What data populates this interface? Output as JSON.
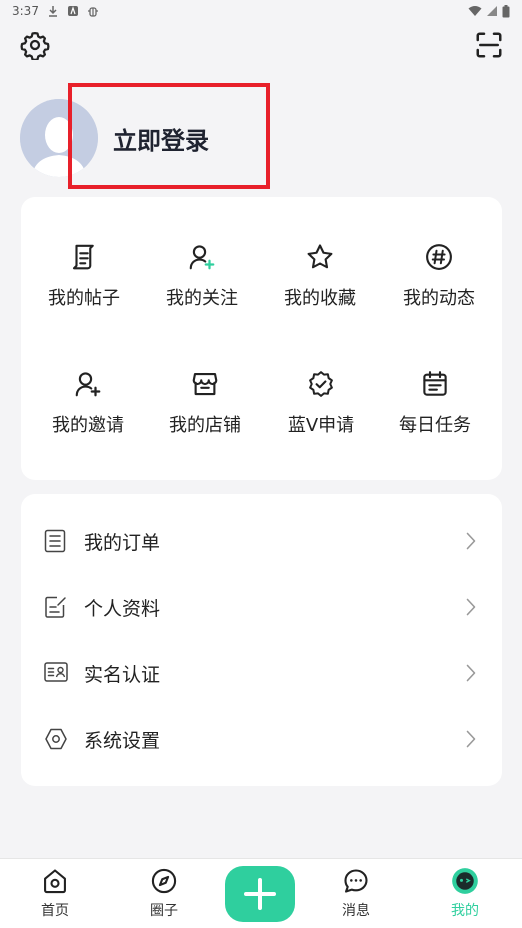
{
  "status_bar": {
    "time": "3:37"
  },
  "profile": {
    "login_label": "立即登录"
  },
  "grid": {
    "items": [
      {
        "label": "我的帖子",
        "icon": "post-icon"
      },
      {
        "label": "我的关注",
        "icon": "follow-user-icon"
      },
      {
        "label": "我的收藏",
        "icon": "star-icon"
      },
      {
        "label": "我的动态",
        "icon": "hashtag-icon"
      },
      {
        "label": "我的邀请",
        "icon": "invite-user-icon"
      },
      {
        "label": "我的店铺",
        "icon": "store-icon"
      },
      {
        "label": "蓝V申请",
        "icon": "verified-badge-icon"
      },
      {
        "label": "每日任务",
        "icon": "calendar-icon"
      }
    ]
  },
  "list": {
    "items": [
      {
        "label": "我的订单",
        "icon": "order-icon"
      },
      {
        "label": "个人资料",
        "icon": "edit-profile-icon"
      },
      {
        "label": "实名认证",
        "icon": "id-card-icon"
      },
      {
        "label": "系统设置",
        "icon": "hexagon-settings-icon"
      }
    ]
  },
  "tabs": [
    {
      "label": "首页",
      "icon": "home-icon"
    },
    {
      "label": "圈子",
      "icon": "compass-icon"
    },
    {
      "label": "消息",
      "icon": "message-icon"
    },
    {
      "label": "我的",
      "icon": "profile-face-icon",
      "active": true
    }
  ],
  "colors": {
    "accent": "#2fcf9e",
    "highlight": "#e8202a",
    "background": "#f4f4f6"
  }
}
